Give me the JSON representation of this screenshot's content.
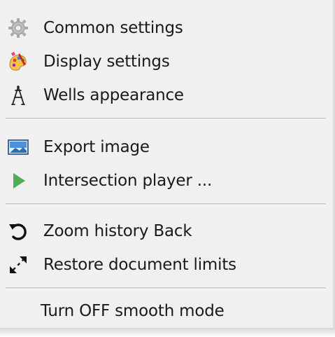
{
  "menu": {
    "items": [
      {
        "label": "Common settings",
        "icon": "gear-icon"
      },
      {
        "label": "Display settings",
        "icon": "palette-icon"
      },
      {
        "label": "Wells appearance",
        "icon": "derrick-icon"
      },
      {
        "label": "Export image",
        "icon": "image-icon"
      },
      {
        "label": "Intersection player ...",
        "icon": "play-icon"
      },
      {
        "label": "Zoom history Back",
        "icon": "undo-arrow-icon"
      },
      {
        "label": "Restore document limits",
        "icon": "expand-arrows-icon"
      },
      {
        "label": "Turn OFF smooth mode",
        "icon": ""
      }
    ]
  },
  "colors": {
    "background": "#f0f0f0",
    "separator": "#cfcfcf",
    "play_green": "#4caf50",
    "text": "#1a1a1a"
  }
}
